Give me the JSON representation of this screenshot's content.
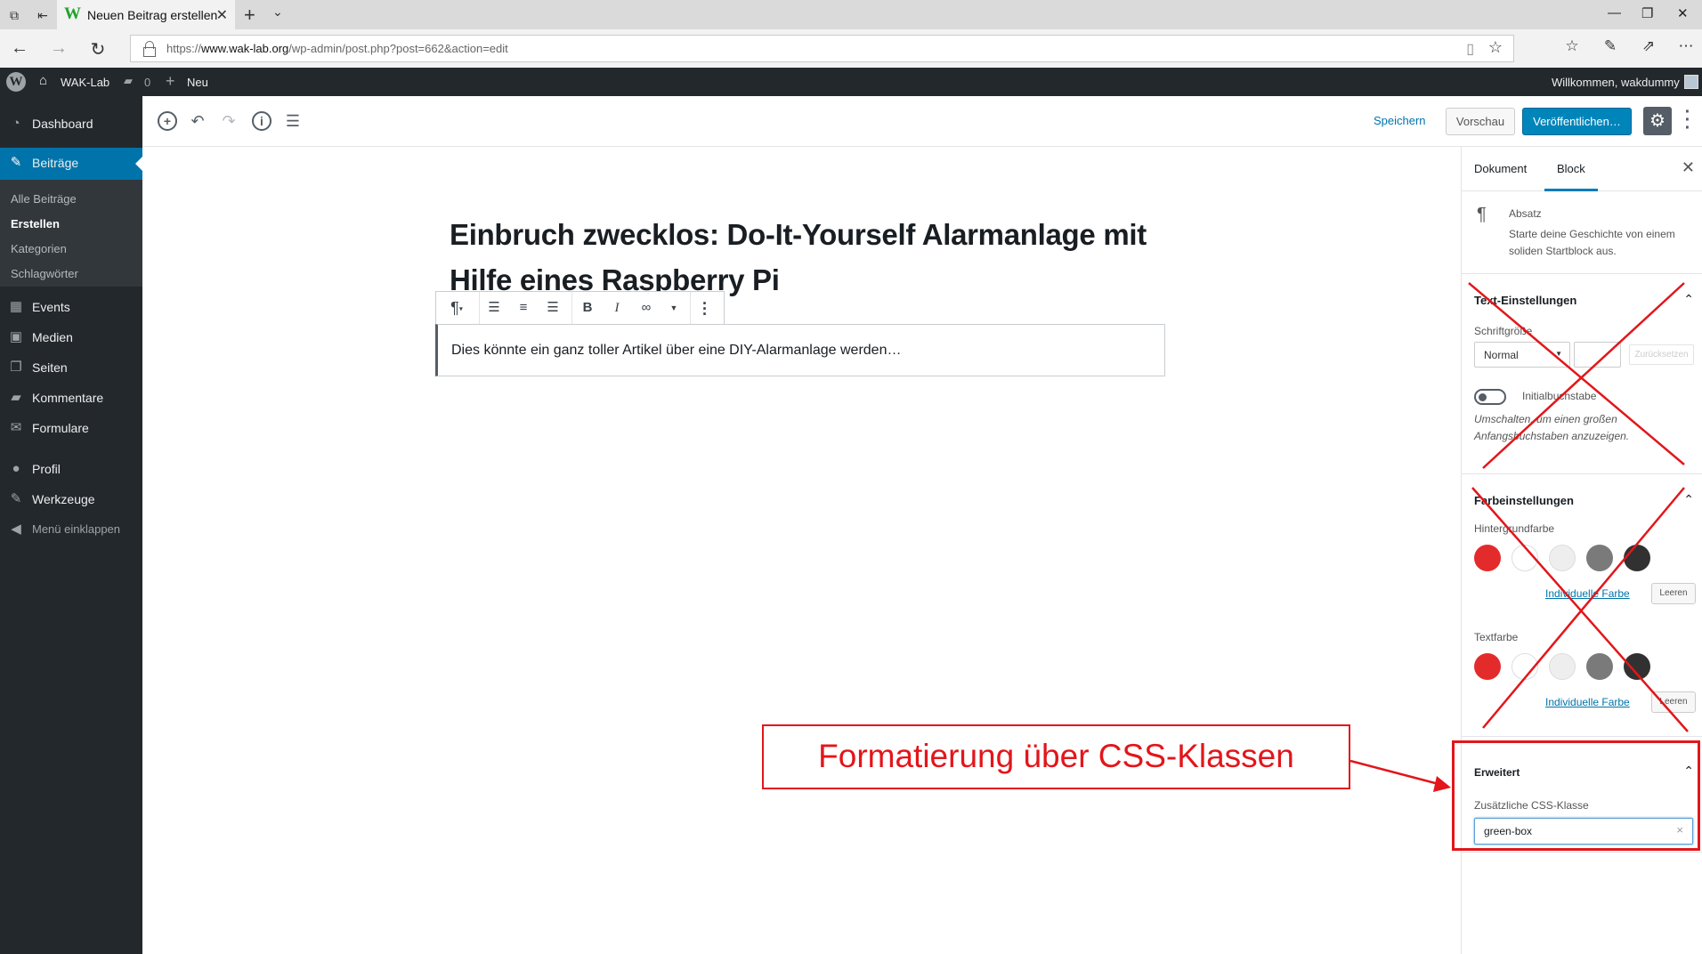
{
  "browser": {
    "tab_title": "Neuen Beitrag erstellen",
    "url_prefix": "https://",
    "url_domain": "www.wak-lab.org",
    "url_path": "/wp-admin/post.php?post=662&action=edit"
  },
  "adminbar": {
    "site": "WAK-Lab",
    "comments_count": "0",
    "new_label": "Neu",
    "greeting": "Willkommen, wakdummy"
  },
  "sidebar": {
    "items": [
      {
        "label": "Dashboard",
        "icon": "dashboard-icon"
      },
      {
        "label": "Beiträge",
        "icon": "pin-icon"
      },
      {
        "label": "Events",
        "icon": "calendar-icon"
      },
      {
        "label": "Medien",
        "icon": "media-icon"
      },
      {
        "label": "Seiten",
        "icon": "pages-icon"
      },
      {
        "label": "Kommentare",
        "icon": "comments-icon"
      },
      {
        "label": "Formulare",
        "icon": "mail-icon"
      },
      {
        "label": "Profil",
        "icon": "user-icon"
      },
      {
        "label": "Werkzeuge",
        "icon": "wrench-icon"
      },
      {
        "label": "Menü einklappen",
        "icon": "collapse-icon"
      }
    ],
    "submenu": [
      "Alle Beiträge",
      "Erstellen",
      "Kategorien",
      "Schlagwörter"
    ]
  },
  "editor": {
    "save_label": "Speichern",
    "preview_label": "Vorschau",
    "publish_label": "Veröffentlichen…",
    "title_line1": "Einbruch zwecklos: Do-It-Yourself Alarmanlage mit",
    "title_line2": "Hilfe eines Raspberry Pi",
    "paragraph": "Dies könnte ein ganz toller Artikel über eine DIY-Alarmanlage werden…"
  },
  "settings": {
    "tab_document": "Dokument",
    "tab_block": "Block",
    "block_name": "Absatz",
    "block_desc_1": "Starte deine Geschichte von einem",
    "block_desc_2": "soliden Startblock aus.",
    "text_settings": {
      "title": "Text-Einstellungen",
      "fontsize_label": "Schriftgröße",
      "fontsize_value": "Normal",
      "reset_label": "Zurücksetzen",
      "dropcap_label": "Initialbuchstabe",
      "dropcap_help_1": "Umschalten, um einen großen",
      "dropcap_help_2": "Anfangsbuchstaben anzuzeigen."
    },
    "color_settings": {
      "title": "Farbeinstellungen",
      "bg_label": "Hintergrundfarbe",
      "text_label": "Textfarbe",
      "custom_label": "Individuelle Farbe",
      "clear_label": "Leeren",
      "palette": [
        "#e42b2b",
        "#ffffff",
        "#eeeeee",
        "#7a7a7a",
        "#313131"
      ]
    },
    "advanced": {
      "title": "Erweitert",
      "css_label": "Zusätzliche CSS-Klasse",
      "css_value": "green-box"
    }
  },
  "annotation": {
    "text": "Formatierung über CSS-Klassen",
    "color": "#e2161b"
  }
}
